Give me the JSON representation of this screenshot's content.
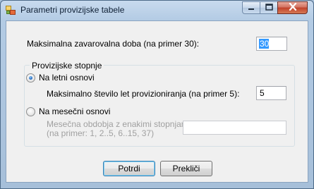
{
  "window": {
    "title": "Parametri provizijske tabele",
    "controls": {
      "minimize": "minimize-icon",
      "maximize": "maximize-icon",
      "close": "close-icon"
    }
  },
  "form": {
    "max_duration": {
      "label": "Maksimalna zavarovalna doba (na primer 30):",
      "value": "30"
    },
    "group_title": "Provizijske stopnje",
    "annual": {
      "label": "Na letni osnovi",
      "selected": true,
      "max_years_label": "Maksimalno število let provizioniranja (na primer 5):",
      "max_years_value": "5"
    },
    "monthly": {
      "label": "Na mesečni osnovi",
      "selected": false,
      "periods_label_line1": "Mesečna obdobja z enakimi stopnjami:",
      "periods_label_line2": "(na primer: 1, 2..5, 6..15, 37)",
      "periods_value": ""
    }
  },
  "buttons": {
    "ok": "Potrdi",
    "cancel": "Prekliči"
  },
  "colors": {
    "accent": "#3399ff",
    "radio_dot": "#2a6fbe",
    "close_button": "#c1412b"
  }
}
